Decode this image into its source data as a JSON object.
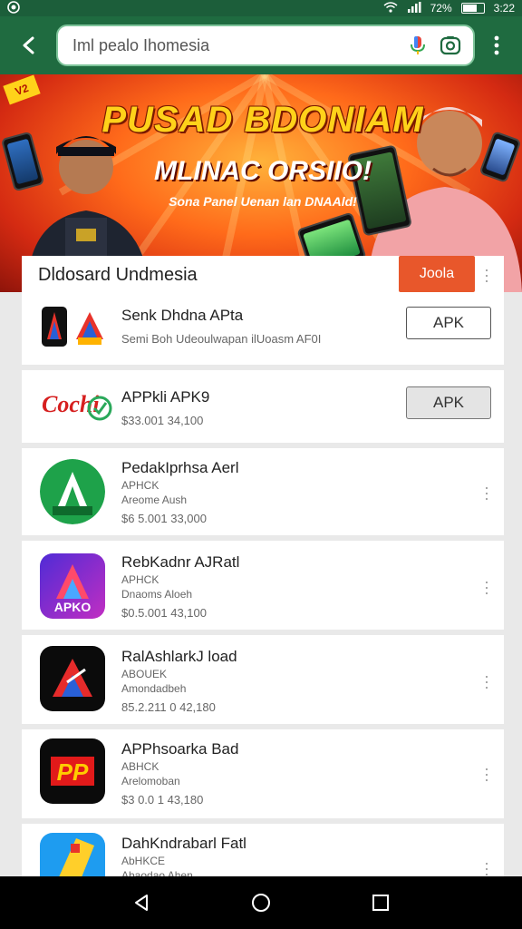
{
  "status_bar": {
    "left_icon": "whatsapp-icon",
    "battery_text": "72%",
    "time": "3:22",
    "battery_level": 0.72
  },
  "toolbar": {
    "search_value": "Iml pealo Ihomesia",
    "back_icon": "back-arrow-icon",
    "mic_icon": "mic-icon",
    "lens_icon": "lens-icon",
    "more_icon": "more-vertical-icon"
  },
  "banner": {
    "badge": "V2",
    "title": "PUSAD BDONIAM",
    "subtitle": "MLINAC ORSIIO!",
    "tagline": "Sona Panel Uenan lan DNAAld!",
    "colors": {
      "top": "#ffb23a",
      "mid": "#ff6a1a",
      "edge": "#d42a12",
      "title": "#ffd21a"
    }
  },
  "list": {
    "header": "Dldosard Undmesia",
    "install_label": "Joola",
    "apps": [
      {
        "name": "Senk Dhdna APta",
        "sub": "",
        "meta": "Semi Boh  Udeoulwapan ilUoasm AF0I",
        "button": "APK",
        "icon": "bundle-icon"
      },
      {
        "name": "APPkli APK9",
        "sub": "",
        "meta": "$33.001  34,100",
        "button": "APK",
        "icon": "cochi-icon"
      },
      {
        "name": "PedakIprhsa Aerl",
        "sub": "APHCK",
        "sub2": "Areome Aush",
        "meta": "$6 5.001  33,000",
        "button": "",
        "icon": "green-a-icon"
      },
      {
        "name": "RebKadnr AJRatl",
        "sub": "APHCK",
        "sub2": "Dnaoms Aloeh",
        "meta": "$0.5.001  43,100",
        "button": "",
        "icon": "purple-a-icon"
      },
      {
        "name": "RalAshlarkJ load",
        "sub": "ABOUEK",
        "sub2": "Amondadbeh",
        "meta": "85.2.211 0  42,180",
        "button": "",
        "icon": "black-a-icon"
      },
      {
        "name": "APPhsoarka Bad",
        "sub": "ABHCK",
        "sub2": "Arelomoban",
        "meta": "$3 0.0 1  43,180",
        "button": "",
        "icon": "red-p-icon"
      },
      {
        "name": "DahKndrabarl Fatl",
        "sub": "AbHKCE",
        "sub2": "Abaodao Ahen",
        "meta": "",
        "button": "",
        "icon": "yellow-icon"
      }
    ]
  },
  "navbar": {
    "back": "nav-back-icon",
    "home": "nav-home-icon",
    "recents": "nav-recents-icon"
  }
}
